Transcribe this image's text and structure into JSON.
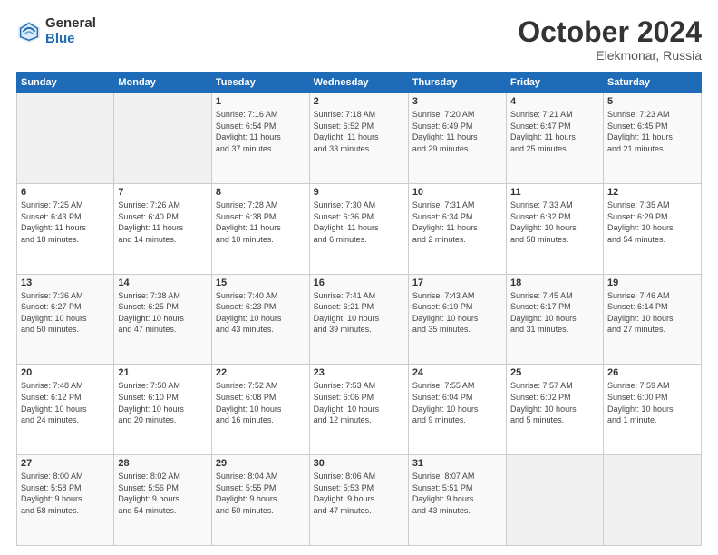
{
  "logo": {
    "general": "General",
    "blue": "Blue"
  },
  "title": "October 2024",
  "location": "Elekmonar, Russia",
  "days_header": [
    "Sunday",
    "Monday",
    "Tuesday",
    "Wednesday",
    "Thursday",
    "Friday",
    "Saturday"
  ],
  "weeks": [
    [
      {
        "day": "",
        "info": ""
      },
      {
        "day": "",
        "info": ""
      },
      {
        "day": "1",
        "info": "Sunrise: 7:16 AM\nSunset: 6:54 PM\nDaylight: 11 hours\nand 37 minutes."
      },
      {
        "day": "2",
        "info": "Sunrise: 7:18 AM\nSunset: 6:52 PM\nDaylight: 11 hours\nand 33 minutes."
      },
      {
        "day": "3",
        "info": "Sunrise: 7:20 AM\nSunset: 6:49 PM\nDaylight: 11 hours\nand 29 minutes."
      },
      {
        "day": "4",
        "info": "Sunrise: 7:21 AM\nSunset: 6:47 PM\nDaylight: 11 hours\nand 25 minutes."
      },
      {
        "day": "5",
        "info": "Sunrise: 7:23 AM\nSunset: 6:45 PM\nDaylight: 11 hours\nand 21 minutes."
      }
    ],
    [
      {
        "day": "6",
        "info": "Sunrise: 7:25 AM\nSunset: 6:43 PM\nDaylight: 11 hours\nand 18 minutes."
      },
      {
        "day": "7",
        "info": "Sunrise: 7:26 AM\nSunset: 6:40 PM\nDaylight: 11 hours\nand 14 minutes."
      },
      {
        "day": "8",
        "info": "Sunrise: 7:28 AM\nSunset: 6:38 PM\nDaylight: 11 hours\nand 10 minutes."
      },
      {
        "day": "9",
        "info": "Sunrise: 7:30 AM\nSunset: 6:36 PM\nDaylight: 11 hours\nand 6 minutes."
      },
      {
        "day": "10",
        "info": "Sunrise: 7:31 AM\nSunset: 6:34 PM\nDaylight: 11 hours\nand 2 minutes."
      },
      {
        "day": "11",
        "info": "Sunrise: 7:33 AM\nSunset: 6:32 PM\nDaylight: 10 hours\nand 58 minutes."
      },
      {
        "day": "12",
        "info": "Sunrise: 7:35 AM\nSunset: 6:29 PM\nDaylight: 10 hours\nand 54 minutes."
      }
    ],
    [
      {
        "day": "13",
        "info": "Sunrise: 7:36 AM\nSunset: 6:27 PM\nDaylight: 10 hours\nand 50 minutes."
      },
      {
        "day": "14",
        "info": "Sunrise: 7:38 AM\nSunset: 6:25 PM\nDaylight: 10 hours\nand 47 minutes."
      },
      {
        "day": "15",
        "info": "Sunrise: 7:40 AM\nSunset: 6:23 PM\nDaylight: 10 hours\nand 43 minutes."
      },
      {
        "day": "16",
        "info": "Sunrise: 7:41 AM\nSunset: 6:21 PM\nDaylight: 10 hours\nand 39 minutes."
      },
      {
        "day": "17",
        "info": "Sunrise: 7:43 AM\nSunset: 6:19 PM\nDaylight: 10 hours\nand 35 minutes."
      },
      {
        "day": "18",
        "info": "Sunrise: 7:45 AM\nSunset: 6:17 PM\nDaylight: 10 hours\nand 31 minutes."
      },
      {
        "day": "19",
        "info": "Sunrise: 7:46 AM\nSunset: 6:14 PM\nDaylight: 10 hours\nand 27 minutes."
      }
    ],
    [
      {
        "day": "20",
        "info": "Sunrise: 7:48 AM\nSunset: 6:12 PM\nDaylight: 10 hours\nand 24 minutes."
      },
      {
        "day": "21",
        "info": "Sunrise: 7:50 AM\nSunset: 6:10 PM\nDaylight: 10 hours\nand 20 minutes."
      },
      {
        "day": "22",
        "info": "Sunrise: 7:52 AM\nSunset: 6:08 PM\nDaylight: 10 hours\nand 16 minutes."
      },
      {
        "day": "23",
        "info": "Sunrise: 7:53 AM\nSunset: 6:06 PM\nDaylight: 10 hours\nand 12 minutes."
      },
      {
        "day": "24",
        "info": "Sunrise: 7:55 AM\nSunset: 6:04 PM\nDaylight: 10 hours\nand 9 minutes."
      },
      {
        "day": "25",
        "info": "Sunrise: 7:57 AM\nSunset: 6:02 PM\nDaylight: 10 hours\nand 5 minutes."
      },
      {
        "day": "26",
        "info": "Sunrise: 7:59 AM\nSunset: 6:00 PM\nDaylight: 10 hours\nand 1 minute."
      }
    ],
    [
      {
        "day": "27",
        "info": "Sunrise: 8:00 AM\nSunset: 5:58 PM\nDaylight: 9 hours\nand 58 minutes."
      },
      {
        "day": "28",
        "info": "Sunrise: 8:02 AM\nSunset: 5:56 PM\nDaylight: 9 hours\nand 54 minutes."
      },
      {
        "day": "29",
        "info": "Sunrise: 8:04 AM\nSunset: 5:55 PM\nDaylight: 9 hours\nand 50 minutes."
      },
      {
        "day": "30",
        "info": "Sunrise: 8:06 AM\nSunset: 5:53 PM\nDaylight: 9 hours\nand 47 minutes."
      },
      {
        "day": "31",
        "info": "Sunrise: 8:07 AM\nSunset: 5:51 PM\nDaylight: 9 hours\nand 43 minutes."
      },
      {
        "day": "",
        "info": ""
      },
      {
        "day": "",
        "info": ""
      }
    ]
  ]
}
